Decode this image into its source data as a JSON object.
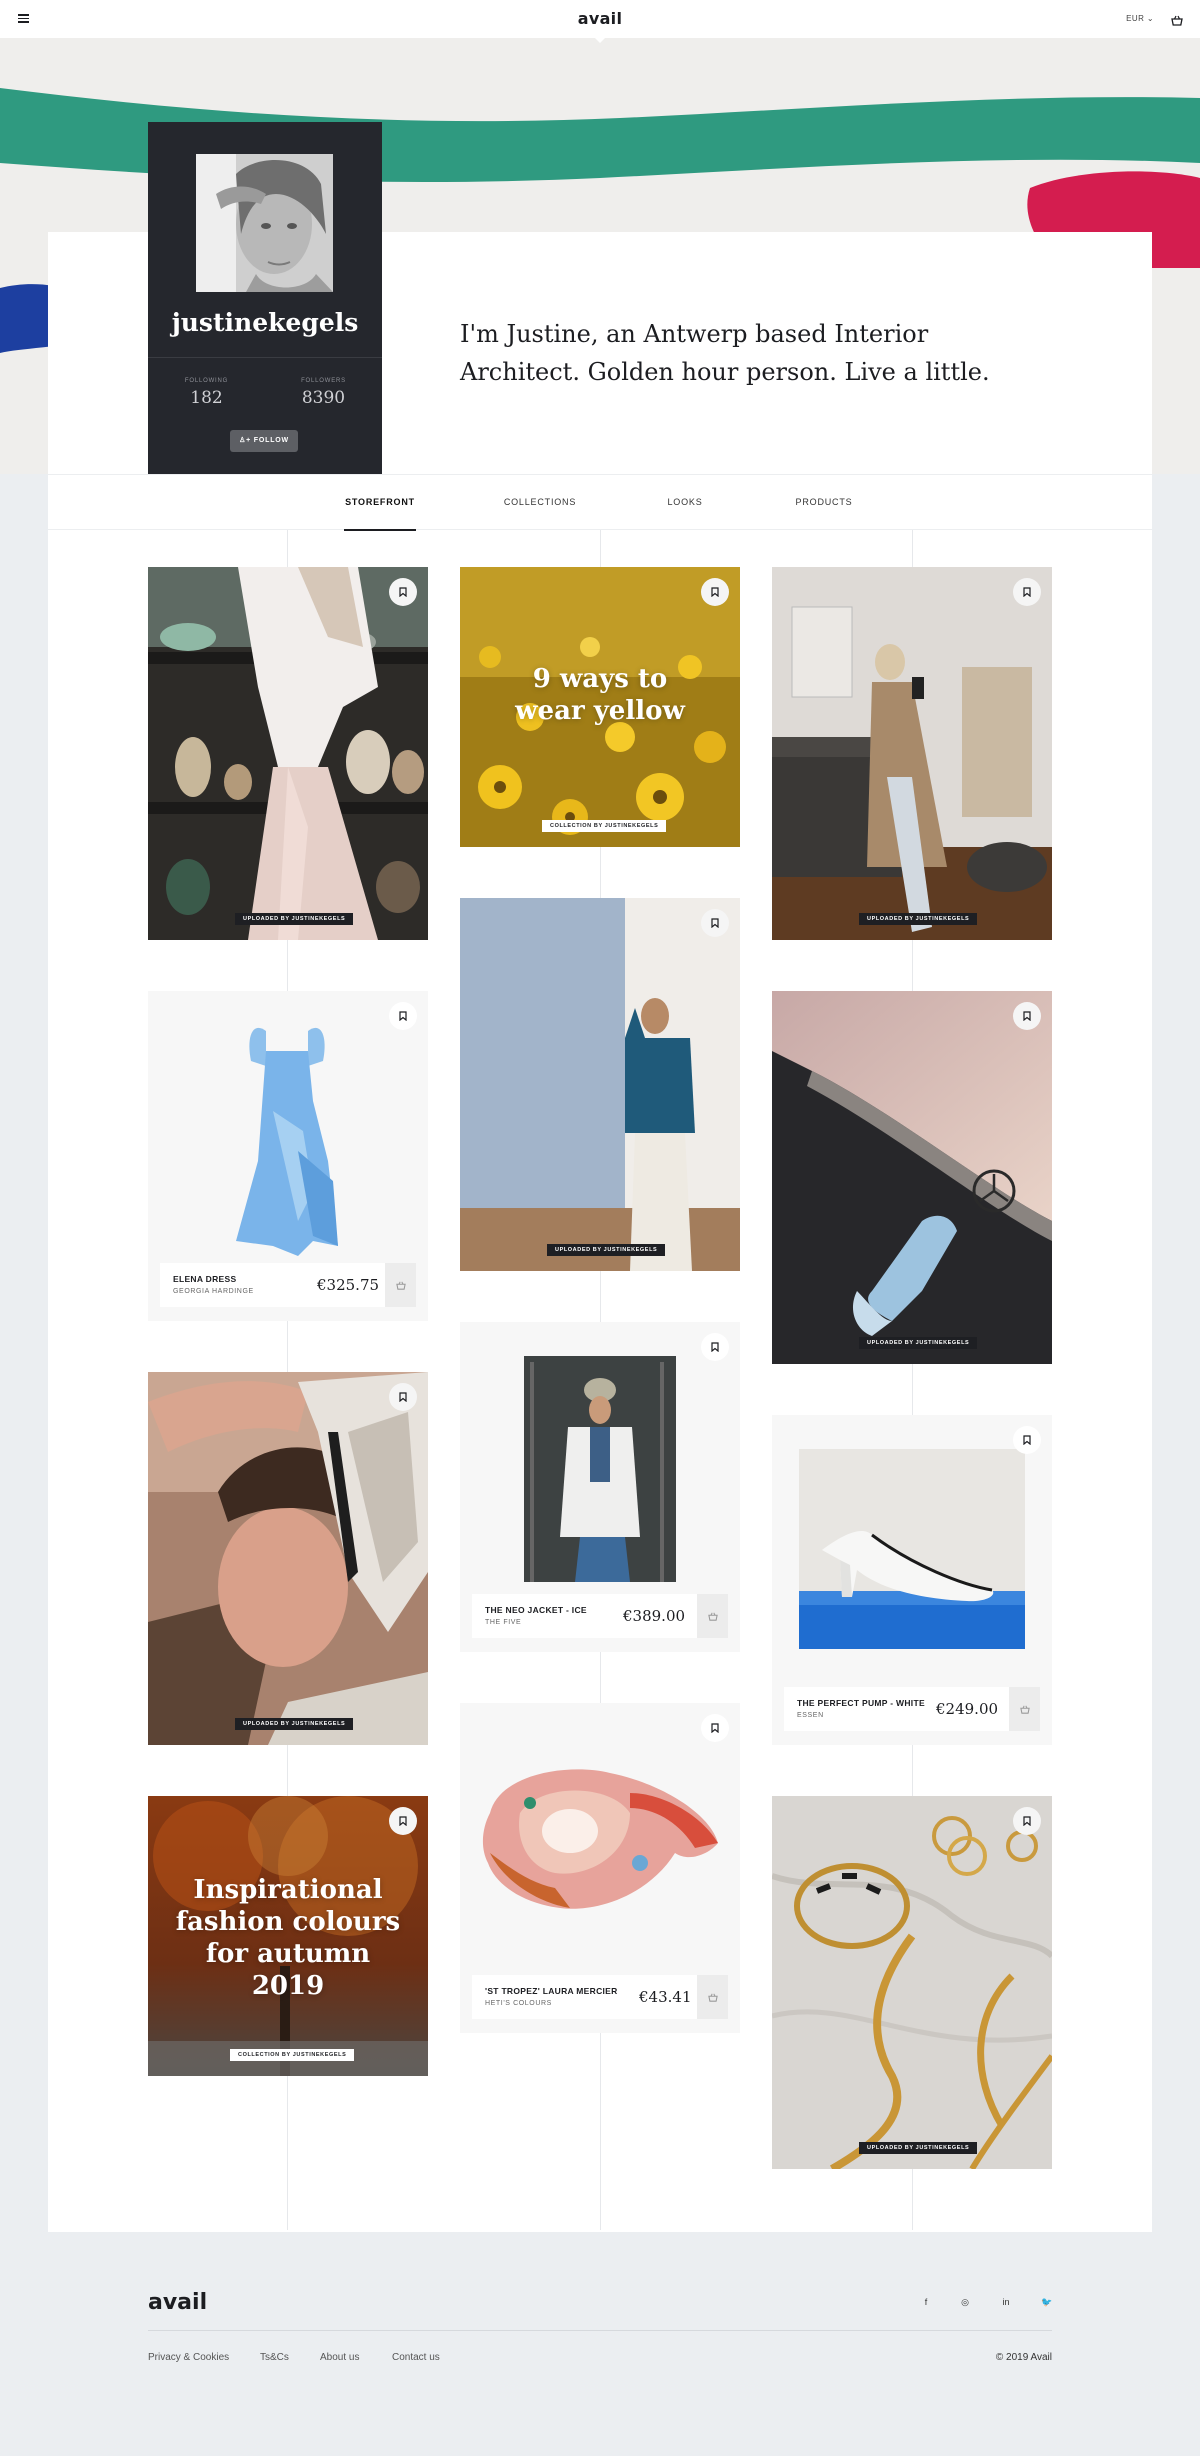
{
  "header": {
    "logo": "avail",
    "currency": "EUR"
  },
  "profile": {
    "username": "justinekegels",
    "following_label": "FOLLOWING",
    "following": "182",
    "followers_label": "FOLLOWERS",
    "followers": "8390",
    "follow_button": "FOLLOW",
    "bio": "I'm Justine, an Antwerp based Interior Architect. Golden hour person. Live a little."
  },
  "tabs": [
    "STOREFRONT",
    "COLLECTIONS",
    "LOOKS",
    "PRODUCTS"
  ],
  "active_tab": "STOREFRONT",
  "badges": {
    "uploaded": "UPLOADED BY JUSTINEKEGELS",
    "collection": "COLLECTION BY JUSTINEKEGELS"
  },
  "collections": {
    "yellow": "9 ways to wear yellow",
    "autumn": "Inspirational fashion colours for autumn 2019"
  },
  "products": {
    "elena": {
      "name": "ELENA DRESS",
      "brand": "GEORGIA HARDINGE",
      "price": "€325.75"
    },
    "neo": {
      "name": "THE NEO JACKET - ICE",
      "brand": "THE FIVE",
      "price": "€389.00"
    },
    "pump": {
      "name": "THE PERFECT PUMP - WHITE",
      "brand": "ESSEN",
      "price": "€249.00"
    },
    "scarf": {
      "name": "'ST TROPEZ' LAURA MERCIER",
      "brand": "HETI'S COLOURS",
      "price": "€43.41"
    }
  },
  "footer": {
    "logo": "avail",
    "links": [
      "Privacy & Cookies",
      "Ts&Cs",
      "About us",
      "Contact us"
    ],
    "social": [
      "f",
      "◎",
      "in",
      "🐦"
    ],
    "copyright": "© 2019 Avail"
  },
  "colors": {
    "dark_card": "#25272d",
    "page_bg": "#ebeef1",
    "accent_teal": "#2e9a7f",
    "accent_red": "#d41d4f",
    "accent_blue": "#1d3fa0"
  }
}
